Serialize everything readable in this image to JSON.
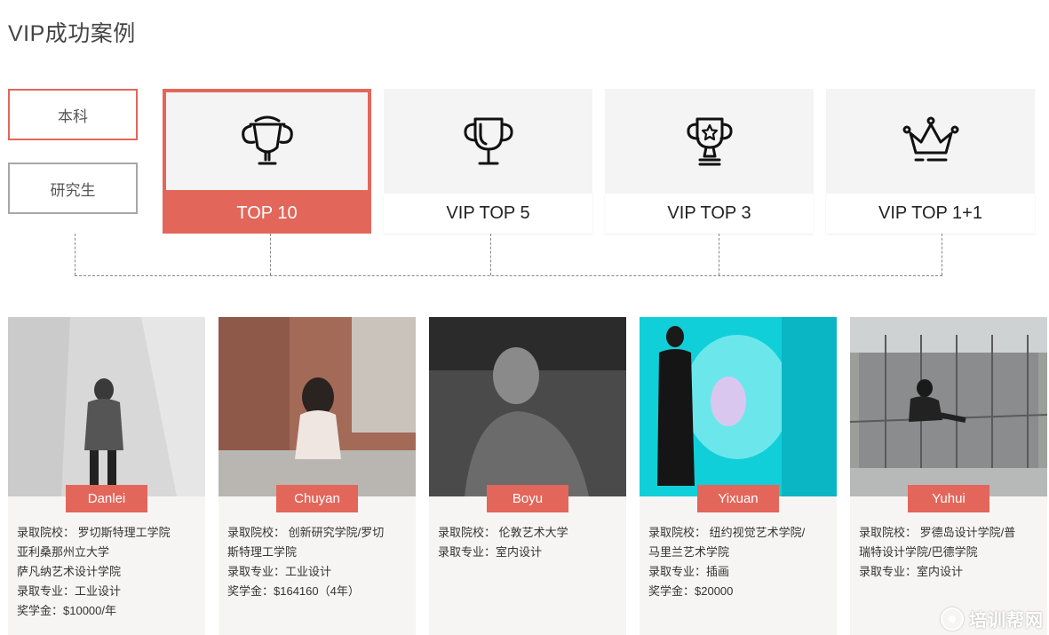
{
  "page": {
    "title": "VIP成功案例"
  },
  "levels": [
    {
      "label": "本科",
      "active": true
    },
    {
      "label": "研究生",
      "active": false
    }
  ],
  "tiers": [
    {
      "label": "TOP 10",
      "icon": "trophy-laurel-icon",
      "active": true
    },
    {
      "label": "VIP TOP 5",
      "icon": "trophy-cup-icon",
      "active": false
    },
    {
      "label": "VIP TOP 3",
      "icon": "trophy-star-icon",
      "active": false
    },
    {
      "label": "VIP TOP 1+1",
      "icon": "crown-icon",
      "active": false
    }
  ],
  "cases": [
    {
      "name": "Danlei",
      "lines": [
        "录取院校： 罗切斯特理工学院",
        "亚利桑那州立大学",
        "萨凡纳艺术设计学院",
        "录取专业：工业设计",
        "奖学金：$10000/年"
      ]
    },
    {
      "name": "Chuyan",
      "lines": [
        "录取院校： 创新研究学院/罗切",
        "斯特理工学院",
        "录取专业：工业设计",
        "奖学金：$164160（4年）"
      ]
    },
    {
      "name": "Boyu",
      "lines": [
        "录取院校： 伦敦艺术大学",
        "录取专业：室内设计"
      ]
    },
    {
      "name": "Yixuan",
      "lines": [
        "录取院校： 纽约视觉艺术学院/",
        "马里兰艺术学院",
        "录取专业：插画",
        "奖学金：$20000"
      ]
    },
    {
      "name": "Yuhui",
      "lines": [
        "录取院校： 罗德岛设计学院/普",
        "瑞特设计学院/巴德学院",
        "录取专业：室内设计"
      ]
    }
  ],
  "watermark": {
    "text": "培训帮网"
  },
  "colors": {
    "accent": "#e3665b",
    "tile_bg": "#f4f4f4",
    "card_bg": "#f6f5f3"
  }
}
